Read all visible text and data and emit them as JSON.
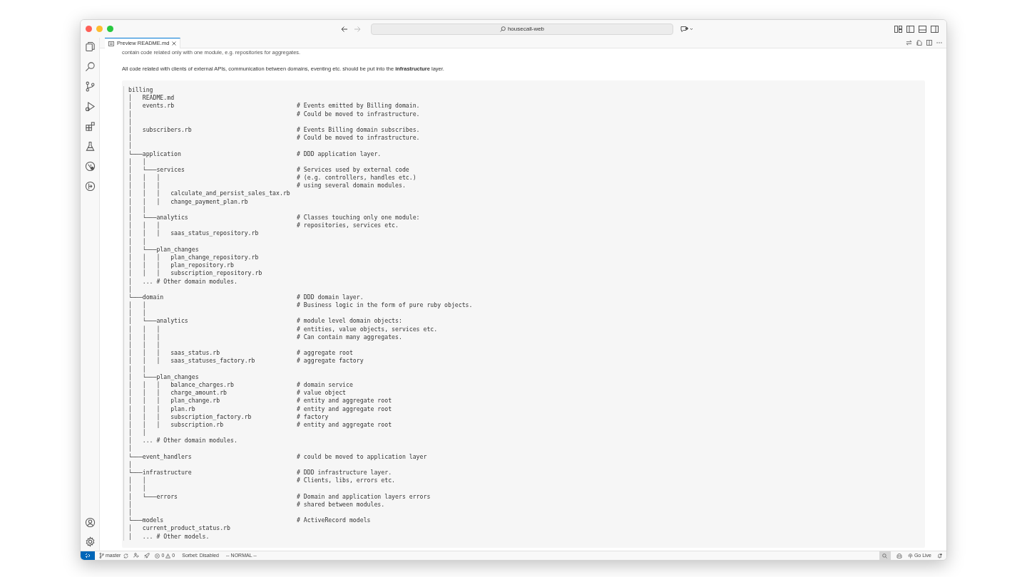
{
  "command_center": {
    "text": "housecall-web"
  },
  "tabs": [
    {
      "label": "Preview README.md",
      "selected": true
    }
  ],
  "preview": {
    "paragraphs": [
      "contain code related only with one module, e.g. repositories for aggregates.",
      "All code related with clients of external APIs, communication between domains, eventing etc. should be put into the **infrastructure** layer."
    ],
    "code_lines": [
      {
        "text": "billing"
      },
      {
        "text": "│   README.md"
      },
      {
        "text": "│   events.rb",
        "comment": "# Events emitted by Billing domain."
      },
      {
        "text": "│",
        "comment": "# Could be moved to infrastructure."
      },
      {
        "text": "│"
      },
      {
        "text": "│   subscribers.rb",
        "comment": "# Events Billing domain subscribes."
      },
      {
        "text": "│",
        "comment": "# Could be moved to infrastructure."
      },
      {
        "text": "│"
      },
      {
        "text": "└───application",
        "comment": "# DDD application layer."
      },
      {
        "text": "│   │"
      },
      {
        "text": "│   └───services",
        "comment": "# Services used by external code"
      },
      {
        "text": "│   │   │",
        "comment": "# (e.g. controllers, handles etc.)"
      },
      {
        "text": "│   │   │",
        "comment": "# using several domain modules."
      },
      {
        "text": "│   │   │   calculate_and_persist_sales_tax.rb"
      },
      {
        "text": "│   │   │   change_payment_plan.rb"
      },
      {
        "text": "│   │"
      },
      {
        "text": "│   └───analytics",
        "comment": "# Classes touching only one module:"
      },
      {
        "text": "│   │   │",
        "comment": "# repositories, services etc."
      },
      {
        "text": "│   │   │   saas_status_repository.rb"
      },
      {
        "text": "│   │"
      },
      {
        "text": "│   └───plan_changes"
      },
      {
        "text": "│   │   │   plan_change_repository.rb"
      },
      {
        "text": "│   │   │   plan_repository.rb"
      },
      {
        "text": "│   │   │   subscription_repository.rb"
      },
      {
        "text": "│   ... # Other domain modules."
      },
      {
        "text": "│"
      },
      {
        "text": "└───domain",
        "comment": "# DDD domain layer."
      },
      {
        "text": "│   │",
        "comment": "# Business logic in the form of pure ruby objects."
      },
      {
        "text": "│   │"
      },
      {
        "text": "│   └───analytics",
        "comment": "# module level domain objects:"
      },
      {
        "text": "│   │   │",
        "comment": "# entities, value objects, services etc."
      },
      {
        "text": "│   │   │",
        "comment": "# Can contain many aggregates."
      },
      {
        "text": "│   │   │"
      },
      {
        "text": "│   │   │   saas_status.rb",
        "comment": "# aggregate root"
      },
      {
        "text": "│   │   │   saas_statuses_factory.rb",
        "comment": "# aggregate factory"
      },
      {
        "text": "│   │"
      },
      {
        "text": "│   └───plan_changes"
      },
      {
        "text": "│   │   │   balance_charges.rb",
        "comment": "# domain service"
      },
      {
        "text": "│   │   │   charge_amount.rb",
        "comment": "# value object"
      },
      {
        "text": "│   │   │   plan_change.rb",
        "comment": "# entity and aggregate root"
      },
      {
        "text": "│   │   │   plan.rb",
        "comment": "# entity and aggregate root"
      },
      {
        "text": "│   │   │   subscription_factory.rb",
        "comment": "# factory"
      },
      {
        "text": "│   │   │   subscription.rb",
        "comment": "# entity and aggregate root"
      },
      {
        "text": "│   │"
      },
      {
        "text": "│   ... # Other domain modules."
      },
      {
        "text": "│"
      },
      {
        "text": "└───event_handlers",
        "comment": "# could be moved to application layer"
      },
      {
        "text": "│"
      },
      {
        "text": "└───infrastructure",
        "comment": "# DDD infrastructure layer."
      },
      {
        "text": "│   │",
        "comment": "# Clients, libs, errors etc."
      },
      {
        "text": "│   │"
      },
      {
        "text": "│   └───errors",
        "comment": "# Domain and application layers errors"
      },
      {
        "text": "│",
        "comment": "# shared between modules."
      },
      {
        "text": "│"
      },
      {
        "text": "└───models",
        "comment": "# ActiveRecord models"
      },
      {
        "text": "│   current_product_status.rb"
      },
      {
        "text": "│   ... # Other models."
      }
    ]
  },
  "status_bar": {
    "branch": "master",
    "errors": "0",
    "warnings": "0",
    "items": [
      "Sorbet: Disabled",
      "-- NORMAL --"
    ],
    "go_live": "Go Live"
  }
}
